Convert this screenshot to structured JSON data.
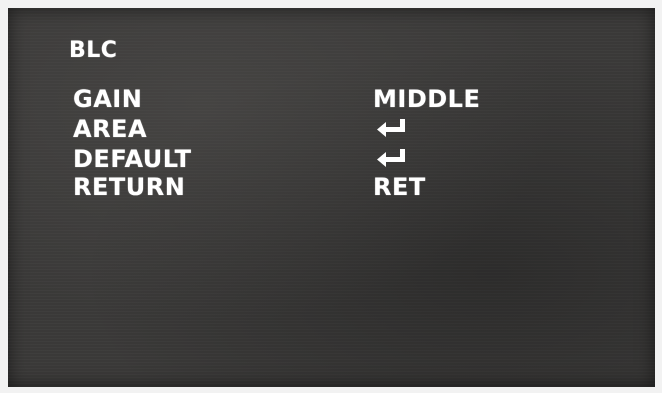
{
  "menu": {
    "title": "BLC",
    "items": [
      {
        "label": "GAIN",
        "value": "MIDDLE"
      },
      {
        "label": "AREA",
        "icon": "enter-arrow-icon"
      },
      {
        "label": "DEFAULT",
        "icon": "enter-arrow-icon"
      },
      {
        "label": "RETURN",
        "value": "RET"
      }
    ]
  },
  "colors": {
    "screen_background": "#3a3938",
    "text": "#ffffff"
  }
}
